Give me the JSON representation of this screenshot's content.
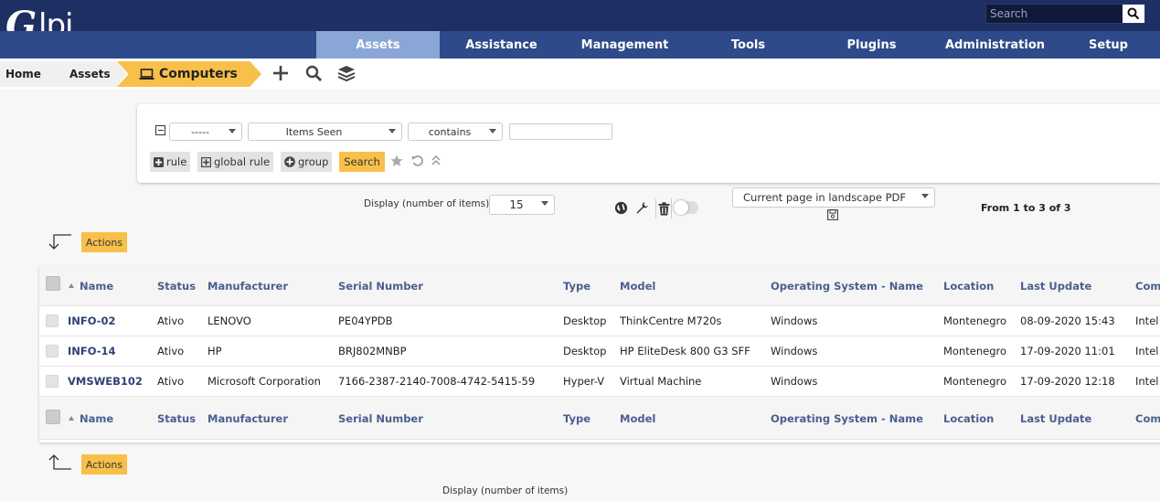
{
  "header": {
    "logo_text": "lpi",
    "search_placeholder": "Search"
  },
  "menu": {
    "items": [
      "Assets",
      "Assistance",
      "Management",
      "Tools",
      "Plugins",
      "Administration",
      "Setup"
    ],
    "active": "Assets"
  },
  "breadcrumb": {
    "home": "Home",
    "assets": "Assets",
    "current": "Computers"
  },
  "search_panel": {
    "link_select": "-----",
    "field_select": "Items Seen",
    "operator_select": "contains",
    "value": "",
    "rule_label": "rule",
    "global_rule_label": "global rule",
    "group_label": "group",
    "search_label": "Search"
  },
  "display": {
    "label": "Display (number of items)",
    "value": "15",
    "export_option": "Current page in landscape PDF",
    "pager": "From 1 to 3 of 3"
  },
  "actions_label": "Actions",
  "table": {
    "columns": [
      "Name",
      "Status",
      "Manufacturer",
      "Serial Number",
      "Type",
      "Model",
      "Operating System - Name",
      "Location",
      "Last Update",
      "Com"
    ],
    "rows": [
      [
        "INFO-02",
        "Ativo",
        "LENOVO",
        "PE04YPDB",
        "Desktop",
        "ThinkCentre M720s",
        "Windows",
        "Montenegro",
        "08-09-2020 15:43",
        "Intel"
      ],
      [
        "INFO-14",
        "Ativo",
        "HP",
        "BRJ802MNBP",
        "Desktop",
        "HP EliteDesk 800 G3 SFF",
        "Windows",
        "Montenegro",
        "17-09-2020 11:01",
        "Intel"
      ],
      [
        "VMSWEB102",
        "Ativo",
        "Microsoft Corporation",
        "7166-2387-2140-7008-4742-5415-59",
        "Hyper-V",
        "Virtual Machine",
        "Windows",
        "Montenegro",
        "17-09-2020 12:18",
        "Intel"
      ]
    ]
  },
  "bottom_display_label": "Display (number of items)",
  "colors": {
    "topbar": "#1d2f63",
    "menubar": "#2e4a8a",
    "menu_active": "#8aa6d6",
    "accent_yellow": "#f8c04a",
    "link": "#2f4276"
  }
}
